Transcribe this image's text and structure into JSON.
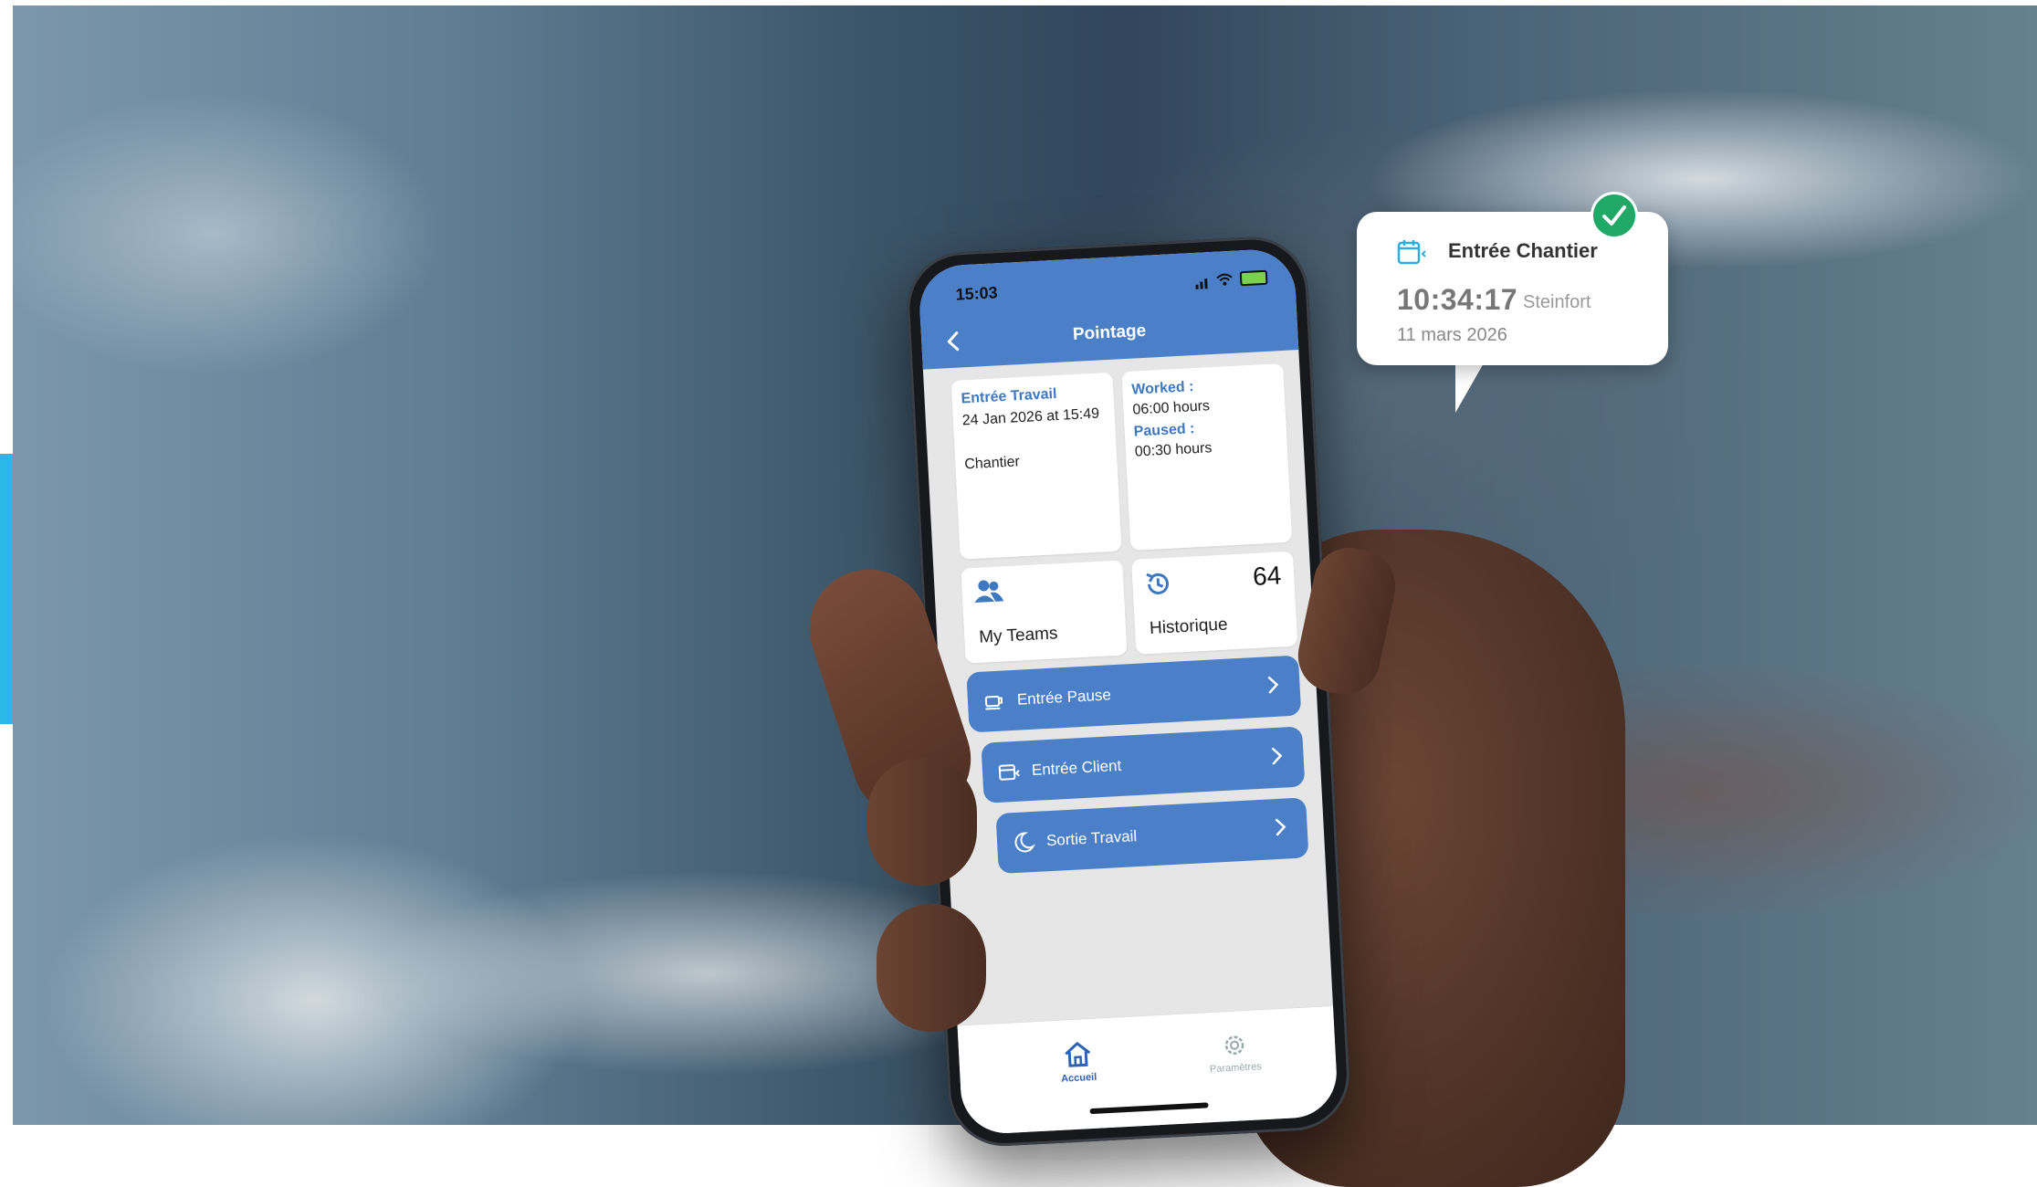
{
  "phone": {
    "status": {
      "time": "15:03"
    },
    "header": {
      "title": "Pointage"
    },
    "entry_card": {
      "label": "Entrée Travail",
      "datetime": "24 Jan 2026 at 15:49",
      "location": "Chantier"
    },
    "stats_card": {
      "worked_label": "Worked :",
      "worked_value": "06:00 hours",
      "paused_label": "Paused :",
      "paused_value": "00:30 hours"
    },
    "teams_card": {
      "label": "My Teams"
    },
    "history_card": {
      "label": "Historique",
      "count": "64"
    },
    "actions": [
      {
        "label": "Entrée Pause"
      },
      {
        "label": "Entrée Client"
      },
      {
        "label": "Sortie Travail"
      }
    ],
    "tabbar": {
      "home_label": "Accueil",
      "settings_label": "Paramètres"
    }
  },
  "notification": {
    "title": "Entrée Chantier",
    "time": "10:34:17",
    "place": "Steinfort",
    "date": "11 mars 2026"
  },
  "colors": {
    "primary": "#4b80c8",
    "accent_bar": "#2ab8e6",
    "success": "#1fa866"
  }
}
